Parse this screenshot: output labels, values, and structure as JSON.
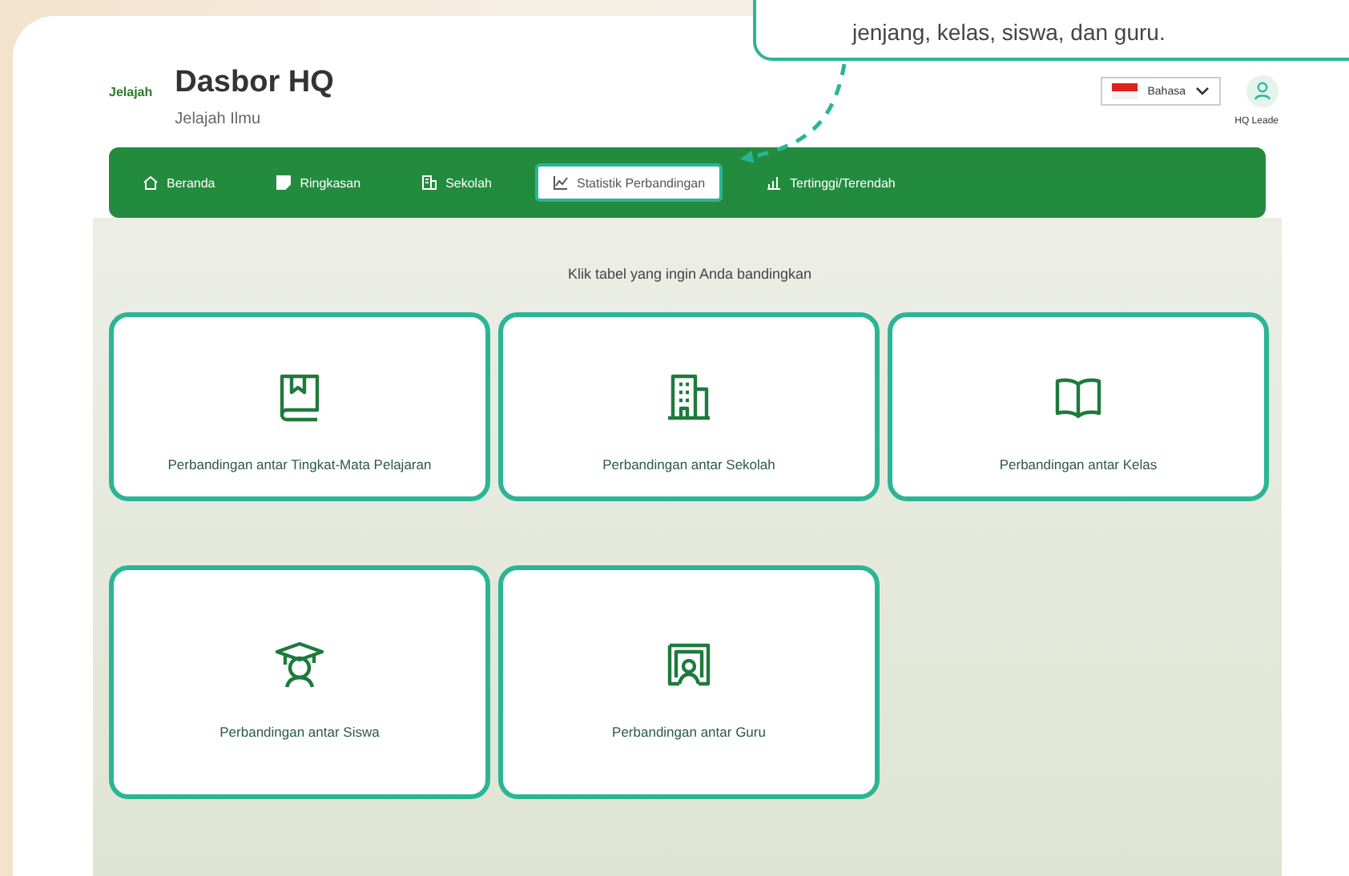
{
  "callout": {
    "text": "jenjang, kelas, siswa, dan guru."
  },
  "header": {
    "logo_text": "Jelajah",
    "title": "Dasbor HQ",
    "subtitle": "Jelajah Ilmu",
    "language": "Bahasa",
    "user": "HQ Leade"
  },
  "nav": [
    {
      "label": "Beranda",
      "selected": false
    },
    {
      "label": "Ringkasan",
      "selected": false
    },
    {
      "label": "Sekolah",
      "selected": false
    },
    {
      "label": "Statistik Perbandingan",
      "selected": true
    },
    {
      "label": "Tertinggi/Terendah",
      "selected": false
    }
  ],
  "instruction": "Klik tabel yang ingin Anda bandingkan",
  "cards": [
    {
      "label": "Perbandingan antar Tingkat-Mata Pelajaran"
    },
    {
      "label": "Perbandingan antar Sekolah"
    },
    {
      "label": "Perbandingan antar Kelas"
    },
    {
      "label": "Perbandingan antar Siswa"
    },
    {
      "label": "Perbandingan antar Guru"
    }
  ]
}
